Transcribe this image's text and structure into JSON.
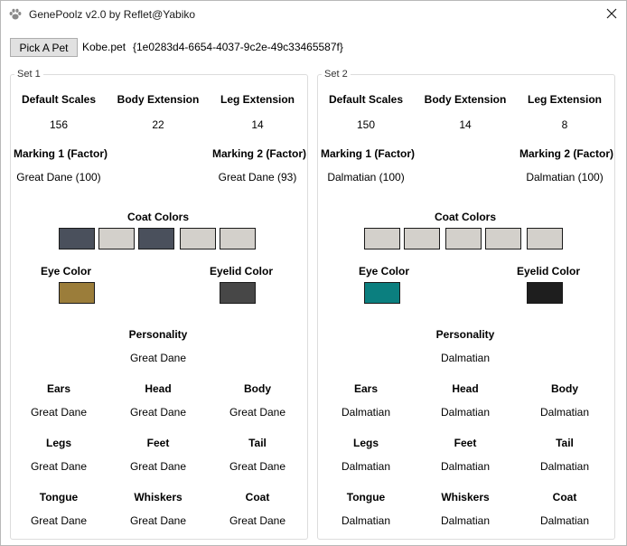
{
  "window": {
    "title": "GenePoolz v2.0 by Reflet@Yabiko",
    "app_icon": "paw-icon",
    "close_icon": "close-icon"
  },
  "toolbar": {
    "pick_label": "Pick A Pet",
    "pet_file": "Kobe.pet",
    "pet_guid": "{1e0283d4-6654-4037-9c2e-49c33465587f}"
  },
  "labels": {
    "default_scales": "Default Scales",
    "body_extension": "Body Extension",
    "leg_extension": "Leg Extension",
    "marking1": "Marking 1 (Factor)",
    "marking2": "Marking 2 (Factor)",
    "coat_colors": "Coat Colors",
    "eye_color": "Eye Color",
    "eyelid_color": "Eyelid Color",
    "personality": "Personality",
    "ears": "Ears",
    "head": "Head",
    "body": "Body",
    "legs": "Legs",
    "feet": "Feet",
    "tail": "Tail",
    "tongue": "Tongue",
    "whiskers": "Whiskers",
    "coat": "Coat"
  },
  "sets": [
    {
      "legend": "Set 1",
      "default_scales": "156",
      "body_extension": "22",
      "leg_extension": "14",
      "marking1": "Great Dane (100)",
      "marking2": "Great Dane (93)",
      "coat_colors": [
        "#4a505c",
        "#d3d0cb",
        "#4a505c",
        "#d3d0cb",
        "#d3d0cb"
      ],
      "eye_color": "#9b7d3a",
      "eyelid_color": "#474747",
      "personality": "Great Dane",
      "ears": "Great Dane",
      "head": "Great Dane",
      "body": "Great Dane",
      "legs": "Great Dane",
      "feet": "Great Dane",
      "tail": "Great Dane",
      "tongue": "Great Dane",
      "whiskers": "Great Dane",
      "coat": "Great Dane"
    },
    {
      "legend": "Set 2",
      "default_scales": "150",
      "body_extension": "14",
      "leg_extension": "8",
      "marking1": "Dalmatian (100)",
      "marking2": "Dalmatian (100)",
      "coat_colors": [
        "#d3d0cb",
        "#d3d0cb",
        "#d3d0cb",
        "#d3d0cb",
        "#d3d0cb"
      ],
      "eye_color": "#0b7f7f",
      "eyelid_color": "#1e1e1e",
      "personality": "Dalmatian",
      "ears": "Dalmatian",
      "head": "Dalmatian",
      "body": "Dalmatian",
      "legs": "Dalmatian",
      "feet": "Dalmatian",
      "tail": "Dalmatian",
      "tongue": "Dalmatian",
      "whiskers": "Dalmatian",
      "coat": "Dalmatian"
    }
  ]
}
